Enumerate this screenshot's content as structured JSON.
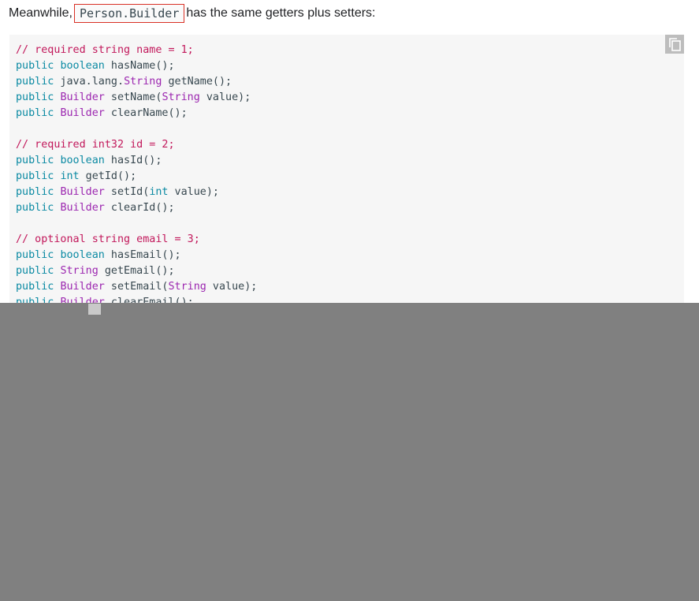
{
  "intro": {
    "before": "Meanwhile,",
    "code": "Person.Builder",
    "after": "has the same getters plus setters:"
  },
  "copy_button": {
    "icon": "copy-icon"
  },
  "code_lines": [
    [
      [
        "comment",
        "// required string name = 1;"
      ]
    ],
    [
      [
        "kw",
        "public"
      ],
      [
        "plain",
        " "
      ],
      [
        "kw",
        "boolean"
      ],
      [
        "plain",
        " hasName();"
      ]
    ],
    [
      [
        "kw",
        "public"
      ],
      [
        "plain",
        " java.lang."
      ],
      [
        "type",
        "String"
      ],
      [
        "plain",
        " getName();"
      ]
    ],
    [
      [
        "kw",
        "public"
      ],
      [
        "plain",
        " "
      ],
      [
        "type",
        "Builder"
      ],
      [
        "plain",
        " setName("
      ],
      [
        "type",
        "String"
      ],
      [
        "plain",
        " value);"
      ]
    ],
    [
      [
        "kw",
        "public"
      ],
      [
        "plain",
        " "
      ],
      [
        "type",
        "Builder"
      ],
      [
        "plain",
        " clearName();"
      ]
    ],
    [
      [
        "plain",
        ""
      ]
    ],
    [
      [
        "comment",
        "// required int32 id = 2;"
      ]
    ],
    [
      [
        "kw",
        "public"
      ],
      [
        "plain",
        " "
      ],
      [
        "kw",
        "boolean"
      ],
      [
        "plain",
        " hasId();"
      ]
    ],
    [
      [
        "kw",
        "public"
      ],
      [
        "plain",
        " "
      ],
      [
        "kw",
        "int"
      ],
      [
        "plain",
        " getId();"
      ]
    ],
    [
      [
        "kw",
        "public"
      ],
      [
        "plain",
        " "
      ],
      [
        "type",
        "Builder"
      ],
      [
        "plain",
        " setId("
      ],
      [
        "kw",
        "int"
      ],
      [
        "plain",
        " value);"
      ]
    ],
    [
      [
        "kw",
        "public"
      ],
      [
        "plain",
        " "
      ],
      [
        "type",
        "Builder"
      ],
      [
        "plain",
        " clearId();"
      ]
    ],
    [
      [
        "plain",
        ""
      ]
    ],
    [
      [
        "comment",
        "// optional string email = 3;"
      ]
    ],
    [
      [
        "kw",
        "public"
      ],
      [
        "plain",
        " "
      ],
      [
        "kw",
        "boolean"
      ],
      [
        "plain",
        " hasEmail();"
      ]
    ],
    [
      [
        "kw",
        "public"
      ],
      [
        "plain",
        " "
      ],
      [
        "type",
        "String"
      ],
      [
        "plain",
        " getEmail();"
      ]
    ],
    [
      [
        "kw",
        "public"
      ],
      [
        "plain",
        " "
      ],
      [
        "type",
        "Builder"
      ],
      [
        "plain",
        " setEmail("
      ],
      [
        "type",
        "String"
      ],
      [
        "plain",
        " value);"
      ]
    ],
    [
      [
        "kw",
        "public"
      ],
      [
        "plain",
        " "
      ],
      [
        "type",
        "Builder"
      ],
      [
        "plain",
        " clearEmail();"
      ]
    ]
  ],
  "colors": {
    "comment": "#c2185b",
    "keyword": "#0b8aa3",
    "type": "#9c27b0",
    "plain": "#37474f",
    "overlay": "#808080",
    "inline_code_border": "#d93025"
  }
}
